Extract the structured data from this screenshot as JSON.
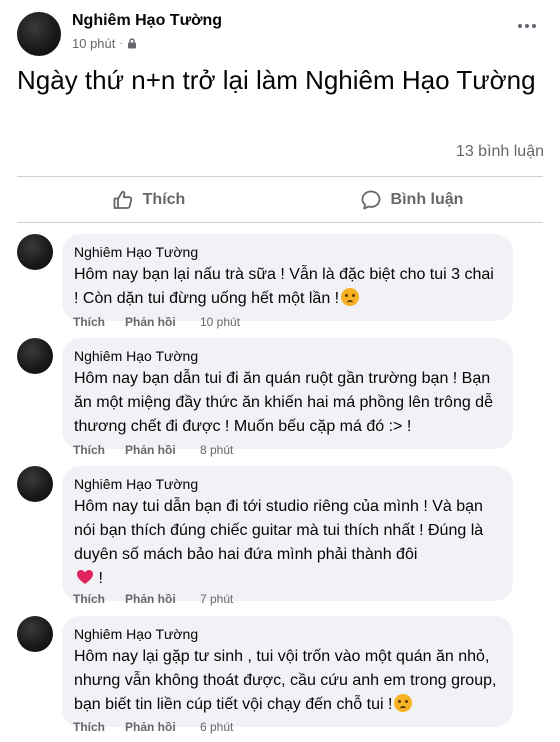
{
  "post": {
    "author": "Nghiêm Hạo Tường",
    "time": "10 phút",
    "text": "Ngày thứ n+n trở lại làm Nghiêm Hạo Tường",
    "comment_count": "13 bình luận"
  },
  "actions": {
    "like_label": "Thích",
    "comment_label": "Bình luận"
  },
  "comment_actions": {
    "like": "Thích",
    "reply": "Phản hồi"
  },
  "comments": [
    {
      "name": "Nghiêm Hạo Tường",
      "text": "Hôm nay bạn lại nấu trà sữa ! Vẫn là đặc biệt cho tui 3 chai ! Còn dặn tui đừng uống hết một lần !",
      "emoji": "sad-face",
      "time": "10 phút"
    },
    {
      "name": "Nghiêm Hạo Tường",
      "text": "Hôm nay bạn dẫn tui đi ăn quán ruột gần trường bạn ! Bạn ăn một miệng đầy thức ăn khiến hai má phồng lên trông dễ thương chết đi được ! Muốn bếu cặp má đó :> !",
      "emoji": "",
      "time": "8 phút"
    },
    {
      "name": "Nghiêm Hạo Tường",
      "text": "Hôm nay tui dẫn bạn đi tới studio riêng của mình ! Và bạn nói bạn thích đúng chiếc guitar mà tui thích nhất ! Đúng là duyên số mách bảo hai đứa mình phải thành đôi",
      "emoji": "red-heart",
      "text_after": " !",
      "time": "7 phút"
    },
    {
      "name": "Nghiêm Hạo Tường",
      "text": "Hôm nay lại gặp tư sinh , tui vội trốn vào một quán ăn nhỏ, nhưng vẫn không thoát được, cầu cứu anh em trong group, bạn biết tin liền cúp tiết vội chạy đến chỗ tui !",
      "emoji": "sad-face",
      "time": "6 phút"
    }
  ],
  "colors": {
    "bubble": "#f0f2f5",
    "secondary_text": "#65676b",
    "divider": "#ced0d4"
  }
}
